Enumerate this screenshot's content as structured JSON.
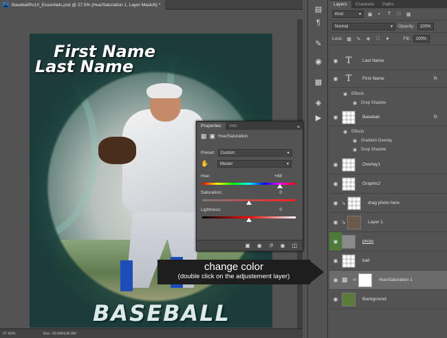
{
  "document": {
    "tab_title": "BaseballRx10_Essentials.psd @ 27.5% (Hue/Saturation 1, Layer Mask/8) *",
    "ps_badge": "Ps",
    "zoom": "27.55%",
    "doc_size": "Doc: 20.6M/106.0M"
  },
  "artwork": {
    "first_name": "First Name",
    "last_name": "Last Name",
    "sport_word": "BASEBALL"
  },
  "tools": [
    "history-icon",
    "paragraph-icon",
    "brush-settings-icon",
    "navigator-icon",
    "swatches-icon",
    "paint-icon",
    "table-icon",
    "adjust-icon",
    "play-icon"
  ],
  "layers_panel": {
    "tabs": [
      "Layers",
      "Channels",
      "Paths"
    ],
    "filter_kind": "Kind",
    "blend_mode": "Normal",
    "opacity_label": "Opacity:",
    "opacity_value": "100%",
    "lock_label": "Lock:",
    "fill_label": "Fill:",
    "fill_value": "100%",
    "layers": [
      {
        "name": "Last Name",
        "type": "text"
      },
      {
        "name": "First Name",
        "type": "text",
        "fx": "fx"
      },
      {
        "name": "Baseball",
        "type": "checker",
        "fx": "fx"
      },
      {
        "name": "Overlay1",
        "type": "checker"
      },
      {
        "name": "Graphic2",
        "type": "checker"
      },
      {
        "name": "drag photo here",
        "type": "checker"
      },
      {
        "name": "Layer 1",
        "type": "photo"
      },
      {
        "name": "photo",
        "type": "gray"
      },
      {
        "name": "ball",
        "type": "checker"
      },
      {
        "name": "Hue/Saturation 1",
        "type": "adjustment"
      },
      {
        "name": "Background",
        "type": "green"
      }
    ],
    "effects_label": "Effects",
    "drop_shadow": "Drop Shadow",
    "gradient_overlay": "Gradient Overlay"
  },
  "properties": {
    "tabs": [
      "Properties",
      "Info"
    ],
    "title": "Hue/Saturation",
    "preset_label": "Preset:",
    "preset_value": "Custom",
    "channel_value": "Master",
    "hue_label": "Hue:",
    "hue_value": "+88",
    "saturation_label": "Saturation:",
    "saturation_value": "0",
    "lightness_label": "Lightness:",
    "lightness_value": "0",
    "hue_fraction": 0.83,
    "saturation_fraction": 0.5,
    "lightness_fraction": 0.5
  },
  "annotation": {
    "line1": "change color",
    "line2": "(double click on the adjustement layer)"
  },
  "colors": {
    "selected_layer": "#6b6b6b",
    "eye_highlight": "#4d7a3b",
    "callout_bg": "#1e1e1e"
  }
}
